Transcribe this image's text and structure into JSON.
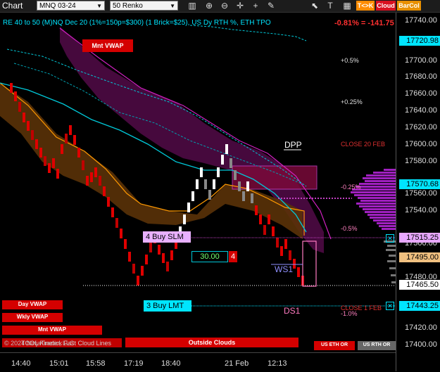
{
  "toolbar": {
    "title": "Chart",
    "instrument": "MNQ 03-24",
    "bar_type": "50 Renko",
    "btn_tkr": "T<>K",
    "btn_cloud": "Cloud",
    "btn_barcol": "BarCol",
    "icons": [
      "chart-bars-icon",
      "zoom-in-icon",
      "zoom-out-icon",
      "crosshair-icon",
      "plus-icon",
      "draw-icon",
      "pointer-icon",
      "text-icon",
      "tile-icon"
    ]
  },
  "header": {
    "info": "RE 40 to 50 (M)NQ Dec 20 (1%=150p=$300) (1 Brick=$25), US Dy RTH %, ETH TPO",
    "change": "-0.81% = -141.75"
  },
  "yaxis": {
    "labels": [
      "17740.00",
      "17720.98",
      "17700.00",
      "17680.00",
      "17660.00",
      "17640.00",
      "17620.00",
      "17600.00",
      "17580.00",
      "17570.68",
      "17560.00",
      "17540.00",
      "17515.25",
      "17500.00",
      "17495.00",
      "17480.00",
      "17465.50",
      "17443.25",
      "17420.00",
      "17400.00"
    ],
    "tags": [
      {
        "value": "17720.98",
        "bg": "#00e5ff",
        "fg": "#000000"
      },
      {
        "value": "17570.68",
        "bg": "#00e5ff",
        "fg": "#000000"
      },
      {
        "value": "17515.25",
        "bg": "#e8a8ff",
        "fg": "#000000"
      },
      {
        "value": "17495.00",
        "bg": "#f0c080",
        "fg": "#000000"
      },
      {
        "value": "17465.50",
        "bg": "#ffffff",
        "fg": "#000000"
      },
      {
        "value": "17443.25",
        "bg": "#00e5ff",
        "fg": "#000000"
      }
    ]
  },
  "xaxis": {
    "labels": [
      "14:40",
      "15:01",
      "15:58",
      "17:19",
      "18:40",
      "21 Feb",
      "12:13"
    ]
  },
  "labels": {
    "mnt_vwap_top": "Mnt VWAP",
    "pct_up_05": "+0.5%",
    "pct_up_025": "+0.25%",
    "dpp": "DPP",
    "close_20_feb": "CLOSE 20 FEB",
    "pct_dn_025": "-0.25%",
    "pct_dn_05": "-0.5%",
    "buy_slm": "4 Buy SLM",
    "order_price": "30.00",
    "order_qty": "4",
    "ws1": "WS1",
    "ds1": "DS1",
    "buy_lmt": "3 Buy LMT",
    "close_1_feb": "CLOSE 1 FEB",
    "pct_dn_1": "-1.0%",
    "day_vwap": "Day VWAP",
    "wkly_vwap": "Wkly VWAP",
    "mnt_vwap_bottom": "Mnt VWAP",
    "watermark": "© 2024 NinjaTrader, LLC",
    "watermark2": "TOOL Kinetick Fast Cloud Lines",
    "outside_clouds": "Outside Clouds",
    "us_eth_or": "US ETH OR",
    "us_rth_or": "US RTH OR"
  },
  "colors": {
    "cyan": "#00e5ff",
    "magenta": "#c020c0",
    "orange": "#ff9900",
    "red": "#e00000"
  }
}
